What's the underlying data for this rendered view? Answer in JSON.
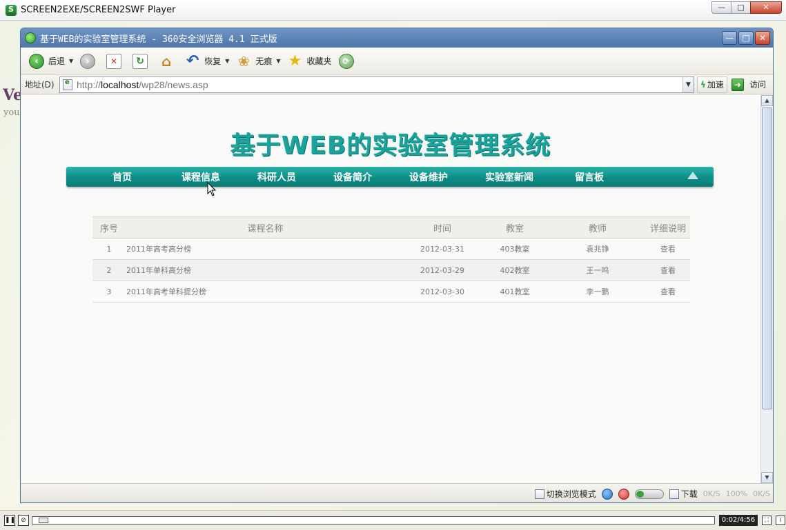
{
  "player": {
    "title": "SCREEN2EXE/SCREEN2SWF Player",
    "time": "0:02/4:56",
    "progress": 0.007,
    "btn_min": "—",
    "btn_max": "□",
    "btn_close": "✕"
  },
  "background": {
    "deco1": "Ve",
    "deco2": "you"
  },
  "browser": {
    "title": "基于WEB的实验室管理系统 - 360安全浏览器 4.1 正式版",
    "toolbar": {
      "back": "后退",
      "restore": "恢复",
      "incognito": "无痕",
      "favorites": "收藏夹"
    },
    "address": {
      "label": "地址(D)",
      "url_prefix": "http://",
      "url_host": "localhost",
      "url_path": "/wp28/news.asp",
      "accelerate": "加速",
      "go": "访问"
    },
    "status": {
      "switch_mode": "切换浏览模式",
      "download": "下载",
      "speed_down": "0K/S",
      "zoom": "100%",
      "speed_up": "0K/S"
    }
  },
  "page": {
    "site_title": "基于WEB的实验室管理系统",
    "nav": [
      "首页",
      "课程信息",
      "科研人员",
      "设备简介",
      "设备维护",
      "实验室新闻",
      "留言板"
    ],
    "table": {
      "headers": [
        "序号",
        "课程名称",
        "时间",
        "教室",
        "教师",
        "详细说明"
      ],
      "rows": [
        {
          "seq": "1",
          "name": "2011年高考高分榜",
          "time": "2012-03-31",
          "room": "403教室",
          "teacher": "袁兆铮",
          "detail": "查看"
        },
        {
          "seq": "2",
          "name": "2011年单科高分榜",
          "time": "2012-03-29",
          "room": "402教室",
          "teacher": "王一鸣",
          "detail": "查看"
        },
        {
          "seq": "3",
          "name": "2011年高考单科提分榜",
          "time": "2012-03-30",
          "room": "401教室",
          "teacher": "李一鹏",
          "detail": "查看"
        }
      ]
    }
  },
  "colors": {
    "accent_teal": "#0d8d86",
    "title_teal": "#1aa39b",
    "browser_blue": "#4f77aa"
  }
}
